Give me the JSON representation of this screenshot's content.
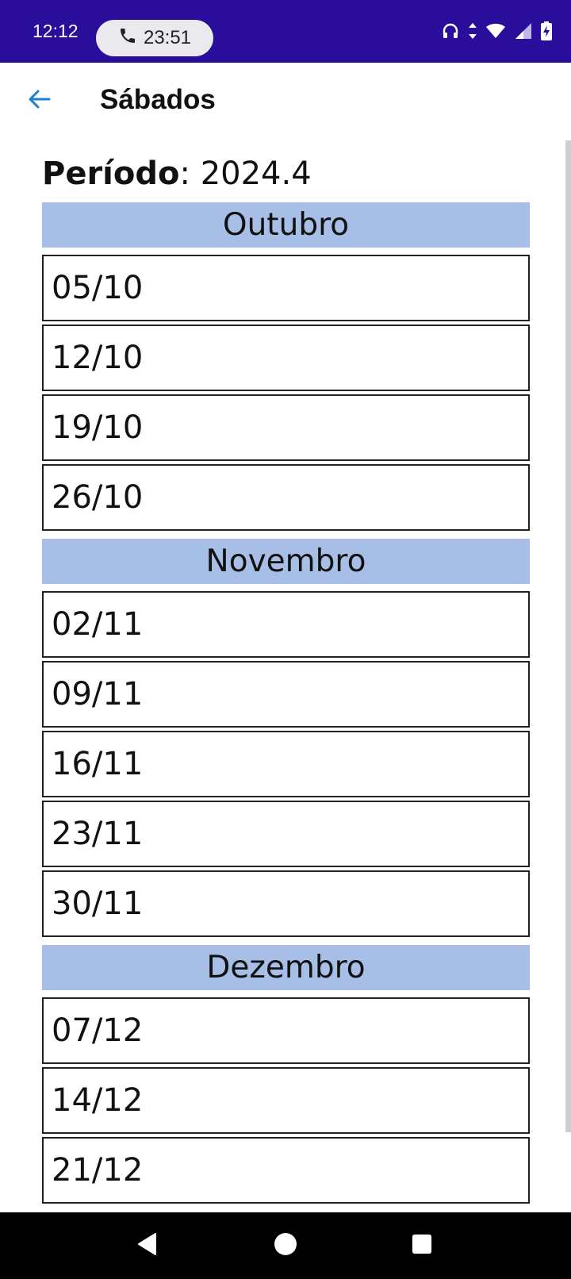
{
  "status_bar": {
    "time": "12:12",
    "call_duration": "23:51",
    "icons": [
      "headset-icon",
      "data-arrows-icon",
      "wifi-icon",
      "signal-icon",
      "battery-charging-icon"
    ]
  },
  "app_bar": {
    "back_icon": "arrow-left-icon",
    "title": "Sábados"
  },
  "period": {
    "label": "Período",
    "separator": ":",
    "value": "2024.4"
  },
  "months": [
    {
      "name": "Outubro",
      "dates": [
        "05/10",
        "12/10",
        "19/10",
        "26/10"
      ]
    },
    {
      "name": "Novembro",
      "dates": [
        "02/11",
        "09/11",
        "16/11",
        "23/11",
        "30/11"
      ]
    },
    {
      "name": "Dezembro",
      "dates": [
        "07/12",
        "14/12",
        "21/12"
      ]
    }
  ],
  "nav_bar": {
    "icons": [
      "back-triangle-icon",
      "home-circle-icon",
      "recents-square-icon"
    ]
  },
  "colors": {
    "status_bar": "#2a0d9a",
    "month_header": "#a7bfe6",
    "accent": "#1e7fd6"
  }
}
